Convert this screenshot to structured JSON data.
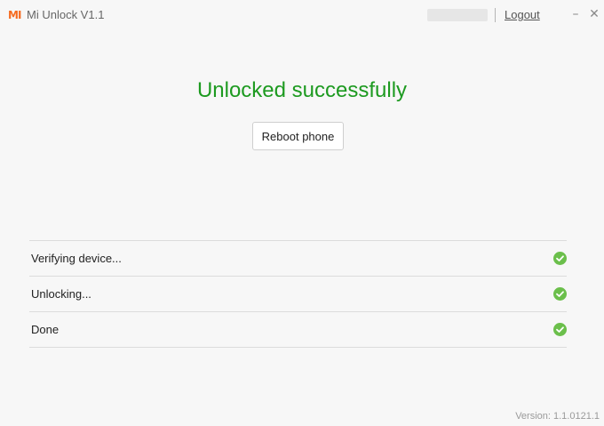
{
  "app": {
    "logo_text": "MI",
    "title": "Mi Unlock  V1.1"
  },
  "titlebar": {
    "logout_label": "Logout",
    "minimize_icon": "–",
    "close_icon": "✕"
  },
  "status": {
    "title": "Unlocked successfully",
    "reboot_label": "Reboot phone"
  },
  "steps": [
    {
      "label": "Verifying device...",
      "icon": "check-icon"
    },
    {
      "label": "Unlocking...",
      "icon": "check-icon"
    },
    {
      "label": "Done",
      "icon": "check-icon"
    }
  ],
  "footer": {
    "version": "Version: 1.1.0121.1"
  },
  "colors": {
    "brand": "#f56b20",
    "success": "#1d9a20",
    "check": "#6bbf4b"
  }
}
